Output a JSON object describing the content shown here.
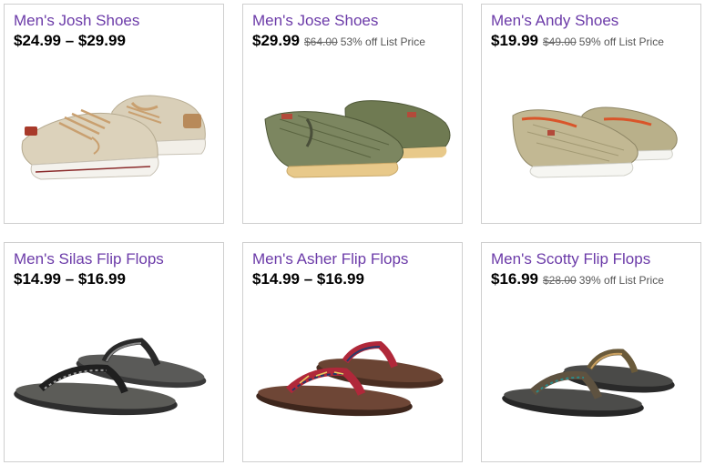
{
  "colors": {
    "title": "#6b3aa8",
    "price": "#000000",
    "border": "#cfcfcf"
  },
  "products": [
    {
      "name": "Men's Josh Shoes",
      "price": "$24.99 – $29.99",
      "old_price": "",
      "discount": "",
      "image_icon": "canvas-sneaker-image"
    },
    {
      "name": "Men's Jose Shoes",
      "price": "$29.99",
      "old_price": "$64.00",
      "discount": "53% off List Price",
      "image_icon": "canvas-slip-on-image"
    },
    {
      "name": "Men's Andy Shoes",
      "price": "$19.99",
      "old_price": "$49.00",
      "discount": "59% off List Price",
      "image_icon": "canvas-slip-on-image"
    },
    {
      "name": "Men's Silas Flip Flops",
      "price": "$14.99 – $16.99",
      "old_price": "",
      "discount": "",
      "image_icon": "flip-flop-image"
    },
    {
      "name": "Men's Asher Flip Flops",
      "price": "$14.99 – $16.99",
      "old_price": "",
      "discount": "",
      "image_icon": "plaid-flip-flop-image"
    },
    {
      "name": "Men's Scotty Flip Flops",
      "price": "$16.99",
      "old_price": "$28.00",
      "discount": "39% off List Price",
      "image_icon": "flip-flop-image"
    }
  ]
}
